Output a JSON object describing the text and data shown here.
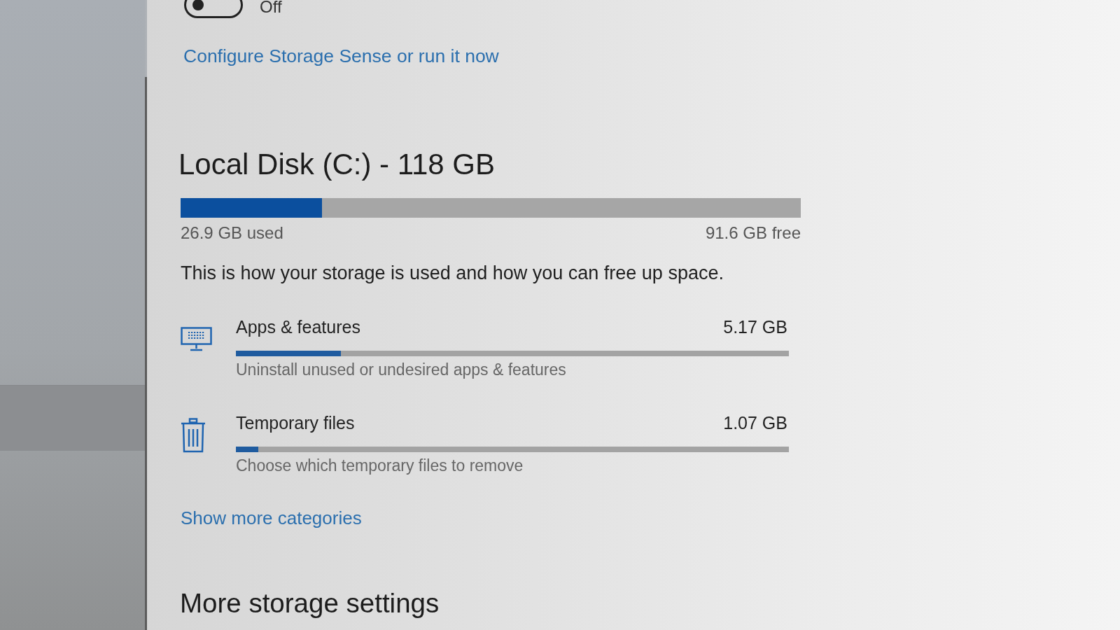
{
  "sidebar": {
    "items": [
      {
        "selected": true
      }
    ]
  },
  "storage_sense": {
    "on": false,
    "state_label": "Off",
    "link": "Configure Storage Sense or run it now"
  },
  "disk": {
    "title": "Local Disk (C:) - 118 GB",
    "level": 0.228,
    "used": "26.9 GB used",
    "free": "91.6 GB free"
  },
  "description": "This is how your storage is used and how you can free up space.",
  "categories": [
    {
      "kind": "apps",
      "title": "Apps & features",
      "size": "5.17 GB",
      "level": 0.19,
      "subtitle": "Uninstall unused or undesired apps & features"
    },
    {
      "kind": "temp",
      "title": "Temporary files",
      "size": "1.07 GB",
      "level": 0.04,
      "subtitle": "Choose which temporary files to remove"
    }
  ],
  "show_more": "Show more categories",
  "more_settings_heading": "More storage settings"
}
